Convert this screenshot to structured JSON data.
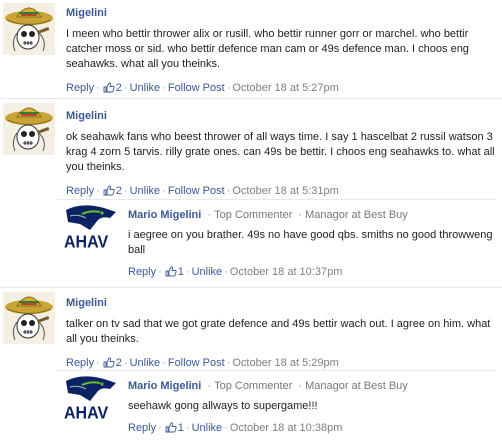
{
  "comments": [
    {
      "author": "Migelini",
      "text": "I meen who bettir thrower alix or rusill. who bettir runner gorr or marchel. who bettir catcher moss or sid. who bettir defence man cam or 49s defence man. I choos eng seahawks. what all you theinks.",
      "reply_label": "Reply",
      "like_count": "2",
      "unlike_label": "Unlike",
      "follow_label": "Follow Post",
      "timestamp": "October 18 at 5:27pm"
    },
    {
      "author": "Migelini",
      "text": "ok seahawk fans who beest thrower of all ways time. I say 1 hascelbat 2 russil watson 3 krag 4 zorn 5 tarvis. rilly grate ones. can 49s be bettir. I choos eng seahawks to. what all you theinks.",
      "reply_label": "Reply",
      "like_count": "2",
      "unlike_label": "Unlike",
      "follow_label": "Follow Post",
      "timestamp": "October 18 at 5:31pm"
    },
    {
      "author": "Migelini",
      "text": "talker on tv sad that we got grate defence and 49s bettir wach out. I agree on him. what all you theinks.",
      "reply_label": "Reply",
      "like_count": "2",
      "unlike_label": "Unlike",
      "follow_label": "Follow Post",
      "timestamp": "October 18 at 5:29pm"
    }
  ],
  "replies": [
    {
      "author": "Mario Migelini",
      "badge": "Top Commenter",
      "role": "Managor at Best Buy",
      "text": "i aegree on you brather. 49s no have good qbs. smiths no good throwweng ball",
      "reply_label": "Reply",
      "like_count": "1",
      "unlike_label": "Unlike",
      "timestamp": "October 18 at 10:37pm",
      "avatar_text": "AHAV"
    },
    {
      "author": "Mario Migelini",
      "badge": "Top Commenter",
      "role": "Managor at Best Buy",
      "text": "seehawk gong allways to supergame!!!",
      "reply_label": "Reply",
      "like_count": "1",
      "unlike_label": "Unlike",
      "timestamp": "October 18 at 10:38pm",
      "avatar_text": "AHAV"
    }
  ],
  "colors": {
    "link": "#3b5998",
    "seahawks_navy": "#0b2265",
    "seahawks_green": "#69be28"
  }
}
